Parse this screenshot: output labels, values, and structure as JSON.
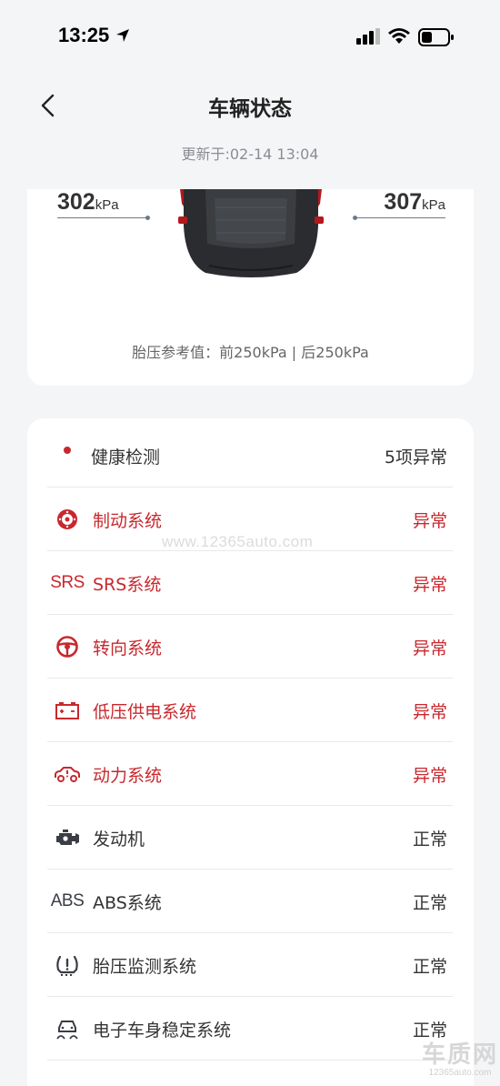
{
  "status_bar": {
    "time": "13:25"
  },
  "header": {
    "title": "车辆状态",
    "updated": "更新于:02-14 13:04"
  },
  "tires": {
    "front_left": {
      "value": "302",
      "unit": "kPa"
    },
    "front_right": {
      "value": "307",
      "unit": "kPa"
    },
    "reference": "胎压参考值：前250kPa | 后250kPa"
  },
  "health": {
    "label": "健康检测",
    "summary": "5项异常",
    "items": [
      {
        "label": "制动系统",
        "status": "异常",
        "icon": "brake-icon"
      },
      {
        "label": "SRS系统",
        "status": "异常",
        "icon": "SRS"
      },
      {
        "label": "转向系统",
        "status": "异常",
        "icon": "steering-wheel-icon"
      },
      {
        "label": "低压供电系统",
        "status": "异常",
        "icon": "battery-icon"
      },
      {
        "label": "动力系统",
        "status": "异常",
        "icon": "powertrain-icon"
      },
      {
        "label": "发动机",
        "status": "正常",
        "icon": "engine-icon"
      },
      {
        "label": "ABS系统",
        "status": "正常",
        "icon": "ABS"
      },
      {
        "label": "胎压监测系统",
        "status": "正常",
        "icon": "tire-pressure-icon"
      },
      {
        "label": "电子车身稳定系统",
        "status": "正常",
        "icon": "stability-control-icon"
      }
    ]
  },
  "watermark": {
    "url": "www.12365auto.com",
    "logo_text": "车质网",
    "logo_url": "12365auto.com"
  },
  "colors": {
    "alert": "#c8282d",
    "normal_text": "#333333",
    "background": "#f4f5f7"
  }
}
